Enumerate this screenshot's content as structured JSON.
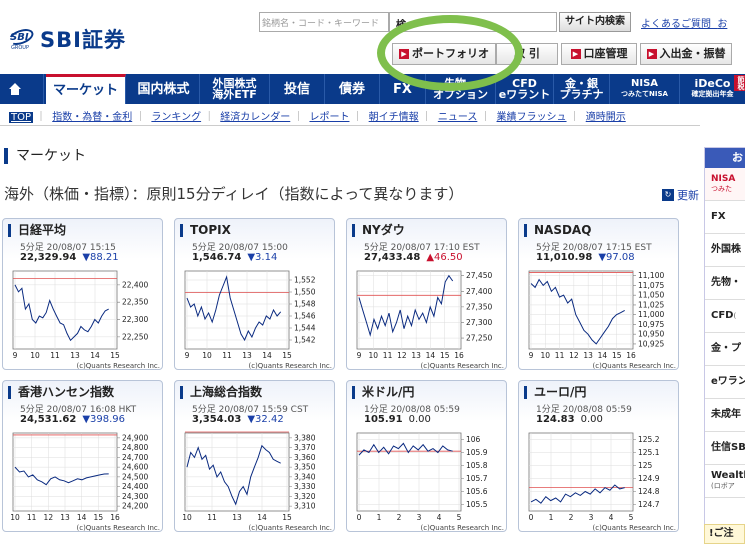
{
  "header": {
    "logo": {
      "mark": "SBI",
      "group": "GROUP",
      "name": "SBI証券"
    },
    "search_placeholder": "銘柄名・コード・キーワード",
    "search_mid_label": "検",
    "site_search_label": "サイト内検索",
    "faq_label": "よくあるご質問",
    "faq_more": "お",
    "buttons": {
      "portfolio": "ポートフォリオ",
      "trade": "取 引",
      "account": "口座管理",
      "deposit": "入出金・振替"
    }
  },
  "nav": {
    "home_icon": "home-icon",
    "items": [
      {
        "label": "マーケット"
      },
      {
        "label": "国内株式"
      },
      {
        "label": "外国株式",
        "label2": "海外ETF"
      },
      {
        "label": "投信"
      },
      {
        "label": "債券"
      },
      {
        "label": "FX"
      },
      {
        "label": "先物・",
        "label2": "オプション"
      },
      {
        "label": "CFD",
        "label2": "eワラント"
      },
      {
        "label": "金・銀",
        "label2": "プラチナ"
      },
      {
        "label": "NISA",
        "label2": "つみたてNISA"
      },
      {
        "label": "iDeCo",
        "label2": "確定拠出年金"
      }
    ],
    "ideco_tag": "節税"
  },
  "subnav": [
    "TOP",
    "指数・為替・金利",
    "ランキング",
    "経済カレンダー",
    "レポート",
    "朝イチ情報",
    "ニュース",
    "業績フラッシュ",
    "適時開示"
  ],
  "page": {
    "title": "マーケット",
    "delay_note": "海外（株価・指標）：原則15分ディレイ（指数によって異なります）",
    "refresh_label": "更新"
  },
  "right_panel": {
    "header": "お",
    "items": [
      {
        "label": "NISA",
        "sub": "つみた"
      },
      {
        "label": "FX"
      },
      {
        "label": "外国株"
      },
      {
        "label": "先物・"
      },
      {
        "label": "CFD",
        "sub": "("
      },
      {
        "label": "金・プ"
      },
      {
        "label": "eワラン"
      },
      {
        "label": "未成年"
      },
      {
        "label": "住信SB"
      },
      {
        "label": "Wealth",
        "sub": "(ロボア"
      }
    ],
    "notice": "!ご注"
  },
  "credit": "(c)Quants Research Inc.",
  "colors": {
    "navy": "#0a3a8a",
    "red": "#c8102e",
    "down": "#1a3fa8",
    "highlight": "#7fbf4c"
  },
  "chart_data": [
    {
      "type": "line",
      "title": "日経平均",
      "time": "5分足 20/08/07 15:15",
      "value": "22,329.94",
      "change": "▼88.21",
      "dir": "down",
      "x_ticks": [
        "9",
        "10",
        "11",
        "13",
        "14",
        "15"
      ],
      "y_ticks": [
        22250,
        22300,
        22350,
        22400
      ],
      "ylim": [
        22215,
        22440
      ],
      "ref": 22418,
      "values": [
        22400,
        22380,
        22390,
        22330,
        22345,
        22300,
        22290,
        22310,
        22305,
        22320,
        22355,
        22330,
        22310,
        22290,
        22285,
        22260,
        22240,
        22250,
        22260,
        22280,
        22270,
        22265,
        22280,
        22300,
        22290,
        22310,
        22325,
        22330
      ]
    },
    {
      "type": "line",
      "title": "TOPIX",
      "time": "5分足 20/08/07 15:00",
      "value": "1,546.74",
      "change": "▼3.14",
      "dir": "down",
      "x_ticks": [
        "9",
        "10",
        "11",
        "13",
        "14",
        "15"
      ],
      "y_ticks": [
        1542,
        1544,
        1546,
        1548,
        1550,
        1552
      ],
      "ylim": [
        1540.5,
        1553.5
      ],
      "ref": 1549.9,
      "values": [
        1549,
        1547.5,
        1548,
        1546,
        1547.5,
        1545.5,
        1546.5,
        1545,
        1547,
        1549.5,
        1551,
        1552.5,
        1549,
        1547,
        1545,
        1543,
        1542,
        1543.5,
        1542.5,
        1544,
        1545,
        1544.5,
        1546,
        1545.5,
        1547,
        1546,
        1546.7
      ]
    },
    {
      "type": "line",
      "title": "NYダウ",
      "time": "5分足 20/08/07 17:10 EST",
      "value": "27,433.48",
      "change": "▲46.50",
      "dir": "up",
      "x_ticks": [
        "9",
        "10",
        "11",
        "12",
        "13",
        "14",
        "15",
        "16"
      ],
      "y_ticks": [
        27250,
        27300,
        27350,
        27400,
        27450
      ],
      "ylim": [
        27215,
        27465
      ],
      "ref": 27387,
      "values": [
        27380,
        27340,
        27300,
        27260,
        27310,
        27280,
        27320,
        27290,
        27330,
        27270,
        27300,
        27340,
        27280,
        27320,
        27290,
        27340,
        27310,
        27330,
        27300,
        27350,
        27320,
        27380,
        27360,
        27430,
        27450,
        27433
      ]
    },
    {
      "type": "line",
      "title": "NASDAQ",
      "time": "5分足 20/08/07 17:15 EST",
      "value": "11,010.98",
      "change": "▼97.08",
      "dir": "down",
      "x_ticks": [
        "9",
        "10",
        "11",
        "12",
        "13",
        "14",
        "15",
        "16"
      ],
      "y_ticks": [
        10925,
        10950,
        10975,
        11000,
        11025,
        11050,
        11075,
        11100
      ],
      "ylim": [
        10912,
        11112
      ],
      "ref": 11108,
      "values": [
        11080,
        11070,
        11090,
        11075,
        11085,
        11060,
        11070,
        11045,
        11050,
        11030,
        11040,
        11000,
        10980,
        10960,
        10950,
        10935,
        10925,
        10940,
        10955,
        10970,
        10990,
        11000,
        11005,
        11011
      ]
    },
    {
      "type": "line",
      "title": "香港ハンセン指数",
      "time": "5分足 20/08/07 16:08 HKT",
      "value": "24,531.62",
      "change": "▼398.96",
      "dir": "down",
      "x_ticks": [
        "10",
        "11",
        "12",
        "13",
        "14",
        "15",
        "16"
      ],
      "y_ticks": [
        24200,
        24300,
        24400,
        24500,
        24600,
        24700,
        24800,
        24900
      ],
      "ylim": [
        24150,
        24950
      ],
      "ref": 24930,
      "values": [
        24600,
        24550,
        24560,
        24500,
        24520,
        24470,
        24450,
        24420,
        24480,
        24500,
        24470,
        24460,
        24440,
        24460,
        24480,
        24470,
        24490,
        24500,
        24510,
        24520,
        24530,
        24531
      ]
    },
    {
      "type": "line",
      "title": "上海総合指数",
      "time": "5分足 20/08/07 15:59 CST",
      "value": "3,354.03",
      "change": "▼32.42",
      "dir": "down",
      "x_ticks": [
        "10",
        "11",
        "13",
        "14",
        "15"
      ],
      "y_ticks": [
        3310,
        3320,
        3330,
        3340,
        3350,
        3360,
        3370,
        3380
      ],
      "ylim": [
        3305,
        3385
      ],
      "ref": 3386,
      "values": [
        3350,
        3365,
        3360,
        3370,
        3358,
        3362,
        3348,
        3352,
        3340,
        3345,
        3335,
        3330,
        3320,
        3312,
        3325,
        3330,
        3322,
        3340,
        3350,
        3360,
        3372,
        3368,
        3365,
        3358,
        3356,
        3354
      ]
    },
    {
      "type": "line",
      "title": "米ドル/円",
      "time": "1分足 20/08/08 05:59",
      "value": "105.91",
      "change": "0.00",
      "dir": "flat",
      "x_ticks": [
        "0",
        "1",
        "2",
        "3",
        "4",
        "5"
      ],
      "y_ticks": [
        105.5,
        105.6,
        105.7,
        105.8,
        105.9,
        106.0
      ],
      "ylim": [
        105.45,
        106.05
      ],
      "ref": 105.91,
      "values": [
        105.88,
        105.92,
        105.9,
        105.96,
        105.9,
        105.94,
        105.89,
        105.95,
        105.93,
        105.97,
        105.9,
        105.95,
        105.92,
        105.96,
        105.91,
        105.93,
        105.9,
        105.95,
        105.92,
        105.91
      ]
    },
    {
      "type": "line",
      "title": "ユーロ/円",
      "time": "1分足 20/08/08 05:59",
      "value": "124.83",
      "change": "0.00",
      "dir": "flat",
      "x_ticks": [
        "0",
        "1",
        "2",
        "3",
        "4",
        "5"
      ],
      "y_ticks": [
        124.7,
        124.8,
        124.9,
        125.0,
        125.1,
        125.2
      ],
      "ylim": [
        124.65,
        125.25
      ],
      "ref": 124.83,
      "values": [
        124.72,
        124.74,
        124.71,
        124.76,
        124.73,
        124.75,
        124.72,
        124.78,
        124.76,
        124.79,
        124.77,
        124.8,
        124.78,
        124.82,
        124.79,
        124.83,
        124.81,
        124.85,
        124.82,
        124.83
      ]
    }
  ]
}
